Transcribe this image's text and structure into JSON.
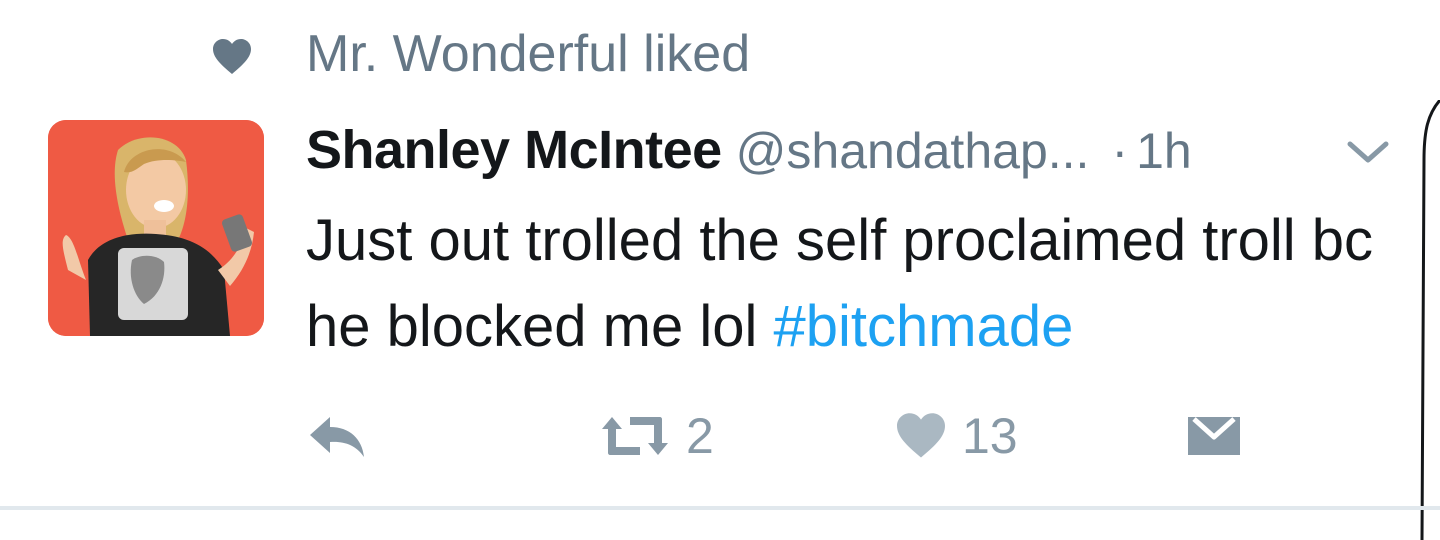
{
  "social_context": {
    "text": "Mr. Wonderful liked",
    "icon": "heart-icon"
  },
  "tweet": {
    "display_name": "Shanley McIntee",
    "handle": "@shandathap...",
    "separator": "·",
    "time": "1h",
    "text": "Just out trolled the self proclaimed troll bc he blocked me lol ",
    "hashtag": "#bitchmade",
    "avatar": {
      "background": "#ef5a44"
    }
  },
  "actions": {
    "reply_icon": "reply-icon",
    "retweet_icon": "retweet-icon",
    "retweet_count": "2",
    "like_icon": "heart-icon",
    "like_count": "13",
    "dm_icon": "envelope-icon"
  },
  "colors": {
    "text_primary": "#14171a",
    "text_secondary": "#657786",
    "icon_gray": "#8899a6",
    "link_blue": "#1da1f2",
    "border": "#e1e8ed"
  }
}
